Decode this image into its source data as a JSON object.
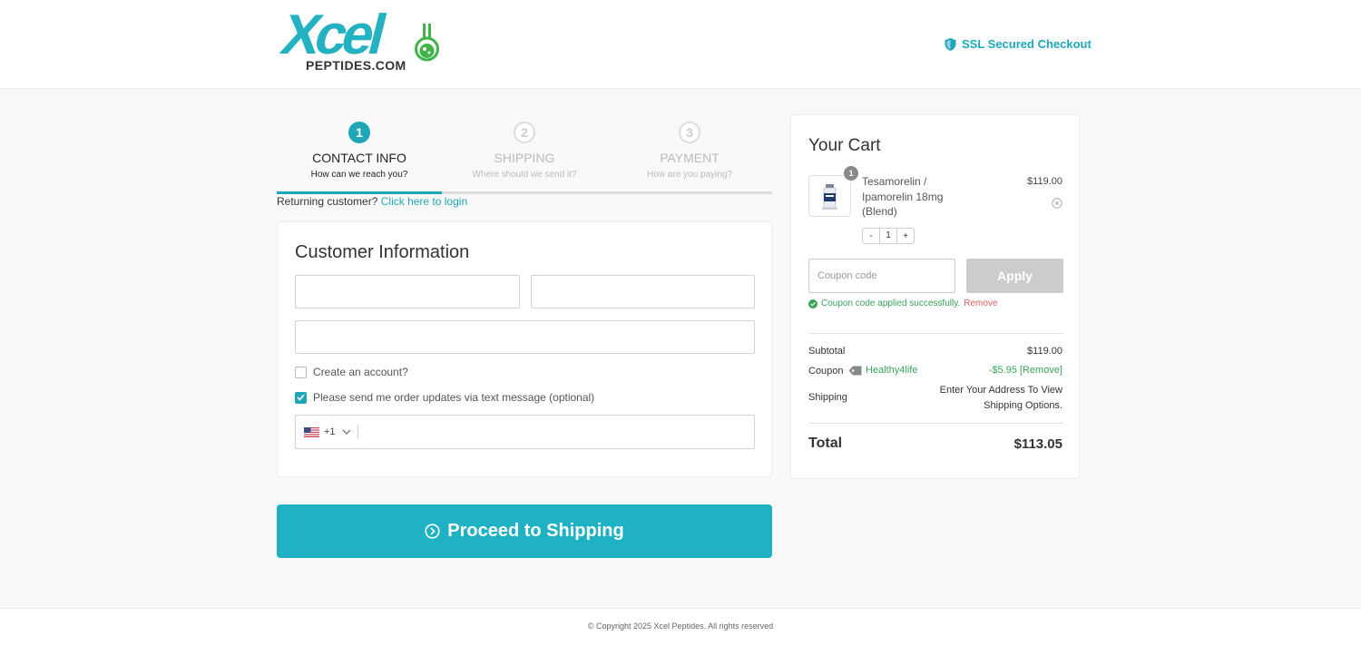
{
  "header": {
    "logo_main": "Xcel",
    "logo_sub": "PEPTIDES.COM",
    "ssl_text": "SSL Secured Checkout"
  },
  "steps": [
    {
      "number": "1",
      "title": "CONTACT INFO",
      "subtitle": "How can we reach you?",
      "active": true
    },
    {
      "number": "2",
      "title": "SHIPPING",
      "subtitle": "Where should we send it?",
      "active": false
    },
    {
      "number": "3",
      "title": "PAYMENT",
      "subtitle": "How are you paying?",
      "active": false
    }
  ],
  "returning": {
    "text": "Returning customer?",
    "link": "Click here to login"
  },
  "form": {
    "title": "Customer Information",
    "create_account_label": "Create an account?",
    "sms_label": "Please send me order updates via text message (optional)",
    "phone_dial_code": "+1"
  },
  "proceed_button": "Proceed to Shipping",
  "cart": {
    "title": "Your Cart",
    "item": {
      "quantity_badge": "1",
      "name": "Tesamorelin / Ipamorelin 18mg (Blend)",
      "price": "$119.00",
      "qty_minus": "-",
      "qty_value": "1",
      "qty_plus": "+"
    },
    "coupon_placeholder": "Coupon code",
    "apply_label": "Apply",
    "coupon_message": "Coupon code applied successfully.",
    "coupon_remove": "Remove",
    "subtotal_label": "Subtotal",
    "subtotal_value": "$119.00",
    "coupon_label": "Coupon",
    "coupon_code": "Healthy4life",
    "coupon_discount": "-$5.95 [Remove]",
    "shipping_label": "Shipping",
    "shipping_value": "Enter Your Address To View Shipping Options.",
    "total_label": "Total",
    "total_value": "$113.05"
  },
  "footer": {
    "copyright": "© Copyright 2025 Xcel Peptides. All rights reserved"
  },
  "colors": {
    "accent": "#1fa7b8",
    "button": "#1fb2c4",
    "success": "#3aa35b",
    "danger": "#e06060"
  }
}
